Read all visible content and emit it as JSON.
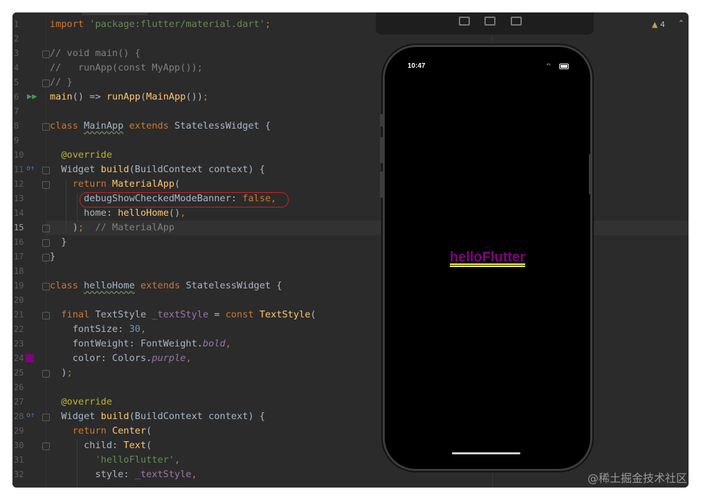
{
  "editor": {
    "lines": [
      {
        "num": "1",
        "html": "<span class=\"kw\">import </span><span class=\"str\">'package:flutter/material.dart'</span><span class=\"kw\">;</span>"
      },
      {
        "num": "2",
        "html": ""
      },
      {
        "num": "3",
        "html": "<span class=\"cm\">// void main() {</span>"
      },
      {
        "num": "4",
        "html": "<span class=\"cm\">//   runApp(const MyApp());</span>"
      },
      {
        "num": "5",
        "html": "<span class=\"cm\">// }</span>"
      },
      {
        "num": "6",
        "html": "<span class=\"fn\">main</span>() => <span class=\"fn\">runApp</span>(<span class=\"fn\">MainApp</span>())<span class=\"kw\">;</span>"
      },
      {
        "num": "7",
        "html": ""
      },
      {
        "num": "8",
        "html": "<span class=\"kw\">class </span><span class=\"sq\">MainApp</span><span class=\"kw\"> extends </span>StatelessWidget {"
      },
      {
        "num": "9",
        "html": ""
      },
      {
        "num": "10",
        "html": "  <span class=\"ann\">@override</span>"
      },
      {
        "num": "11",
        "html": "  Widget <span class=\"fn\">build</span>(BuildContext context) {"
      },
      {
        "num": "12",
        "html": "    <span class=\"kw\">return </span><span class=\"fn\">MaterialApp</span>("
      },
      {
        "num": "13",
        "html": "      debugShowCheckedModeBanner: <span class=\"kw\">false,</span>"
      },
      {
        "num": "14",
        "html": "      home: <span class=\"fn\">helloHome</span>()<span class=\"kw\">,</span>"
      },
      {
        "num": "15",
        "html": "    )<span class=\"kw\">;</span>  <span class=\"cm\">// MaterialApp</span>"
      },
      {
        "num": "16",
        "html": "  }"
      },
      {
        "num": "17",
        "html": "}"
      },
      {
        "num": "18",
        "html": ""
      },
      {
        "num": "19",
        "html": "<span class=\"kw\">class </span><span class=\"sq\">helloHome</span><span class=\"kw\"> extends </span>StatelessWidget {"
      },
      {
        "num": "20",
        "html": ""
      },
      {
        "num": "21",
        "html": "  <span class=\"kw\">final </span>TextStyle <span class=\"field\">_textStyle</span> = <span class=\"kw\">const </span><span class=\"fn\">TextStyle</span>("
      },
      {
        "num": "22",
        "html": "    fontSize: <span class=\"num\">30</span><span class=\"kw\">,</span>"
      },
      {
        "num": "23",
        "html": "    fontWeight: FontWeight.<span class=\"purple\">bold</span><span class=\"kw\">,</span>"
      },
      {
        "num": "24",
        "html": "    color: Colors.<span class=\"purple\">purple</span><span class=\"kw\">,</span>"
      },
      {
        "num": "25",
        "html": "  )<span class=\"kw\">;</span>"
      },
      {
        "num": "26",
        "html": ""
      },
      {
        "num": "27",
        "html": "  <span class=\"ann\">@override</span>"
      },
      {
        "num": "28",
        "html": "  Widget <span class=\"fn\">build</span>(BuildContext context) {"
      },
      {
        "num": "29",
        "html": "    <span class=\"kw\">return </span><span class=\"fn\">Center</span>("
      },
      {
        "num": "30",
        "html": "      child: <span class=\"fn\">Text</span>("
      },
      {
        "num": "31",
        "html": "        <span class=\"str\">'helloFlutter'</span><span class=\"kw\">,</span>"
      },
      {
        "num": "32",
        "html": "        style: <span class=\"field\">_textStyle</span><span class=\"kw\">,</span>"
      }
    ],
    "current_line": "15",
    "inspection": {
      "icon": "warning-icon",
      "count": "4"
    },
    "colors": {
      "background": "#2b2b2b",
      "keyword": "#cc7832",
      "string": "#6a8759",
      "function": "#ffc66d",
      "annotation": "#bbb529",
      "swatch": "#800080",
      "highlight_box": "#c0232c"
    }
  },
  "phone": {
    "status_time": "10:47",
    "status_icons": [
      "wifi-icon",
      "battery-icon"
    ],
    "content_text": "helloFlutter",
    "content_color": "#800080"
  },
  "watermark": "@稀土掘金技术社区"
}
